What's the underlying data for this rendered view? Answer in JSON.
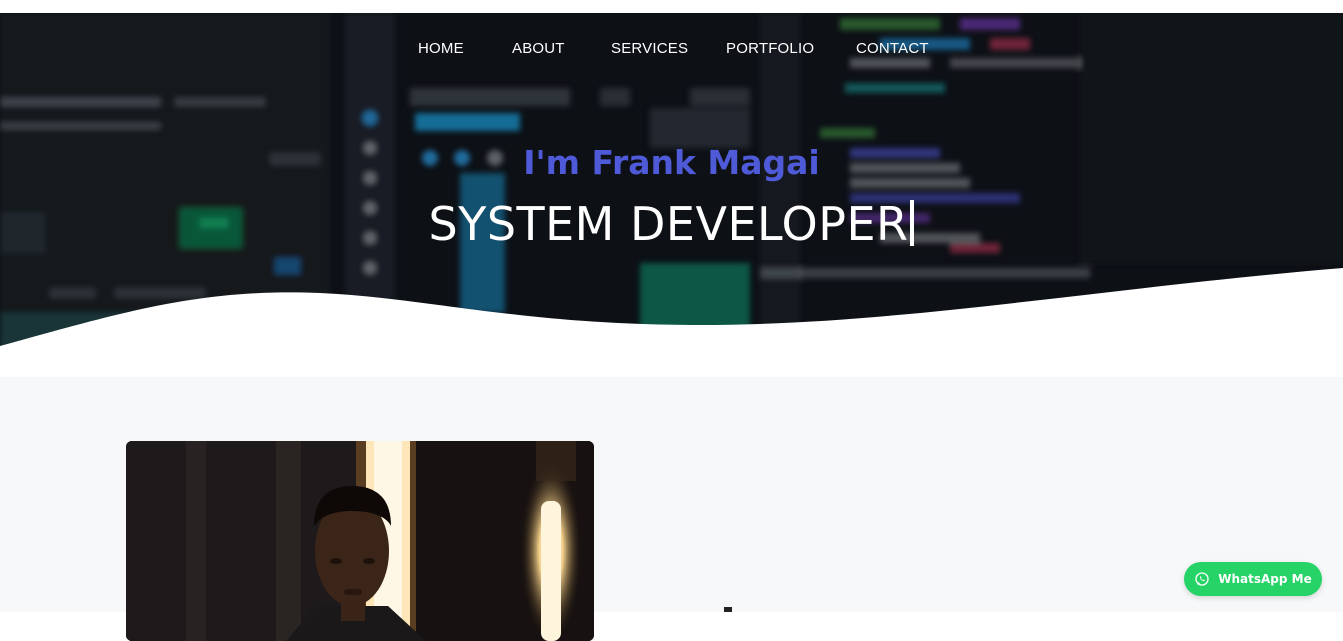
{
  "nav": {
    "items": [
      {
        "label": "HOME"
      },
      {
        "label": "ABOUT"
      },
      {
        "label": "SERVICES"
      },
      {
        "label": "PORTFOLIO"
      },
      {
        "label": "CONTACT"
      }
    ]
  },
  "hero": {
    "greeting": "I'm Frank Magai",
    "role": "SYSTEM DEVELOPER"
  },
  "whatsapp": {
    "label": "WhatsApp Me"
  },
  "colors": {
    "accent": "#4f5ad8",
    "whatsapp": "#25d366",
    "section_bg": "#f7f8fa"
  }
}
